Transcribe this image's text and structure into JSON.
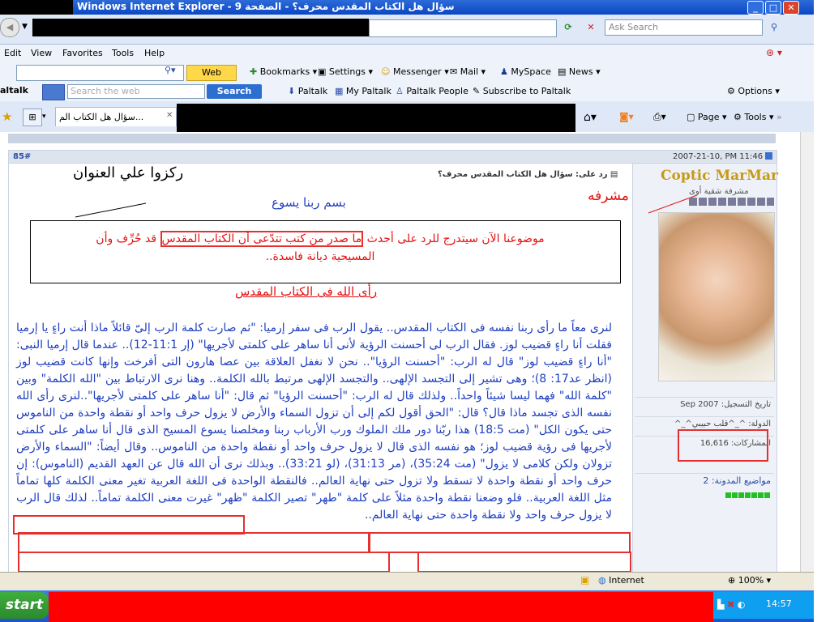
{
  "window": {
    "title": "Windows Internet Explorer - سؤال هل الكتاب المقدس محرف؟ - الصفحة 9",
    "controls": {
      "minimize": "_",
      "maximize": "□",
      "close": "✕"
    }
  },
  "address_bar": {
    "search_placeholder": "Ask Search",
    "refresh_icon": "refresh-icon",
    "stop_icon": "stop-icon"
  },
  "menu": {
    "items": [
      "Edit",
      "View",
      "Favorites",
      "Tools",
      "Help"
    ]
  },
  "toolbar1": {
    "web_search": "Web Search",
    "bookmarks": "Bookmarks",
    "settings": "Settings",
    "messenger": "Messenger",
    "mail": "Mail",
    "myspace": "MySpace",
    "news": "News"
  },
  "toolbar2": {
    "brand": "altalk",
    "search_placeholder": "Search the web",
    "search_button": "Search",
    "paltalk": "Paltalk",
    "my_paltalk": "My Paltalk",
    "paltalk_people": "Paltalk People",
    "subscribe": "Subscribe to Paltalk",
    "options": "Options"
  },
  "tabs": {
    "active_tab": "سؤال هل الكتاب الم...",
    "page_menu": "Page",
    "tools_menu": "Tools"
  },
  "post": {
    "number": "85#",
    "datetime": "2007-21-10, PM 11:46",
    "reply_title": "رد على: سؤال هل الكتاب المقدس محرف؟",
    "annotation_focus": "ركزوا علي العنوان",
    "annotation_moderator": "مشرفه",
    "basmala": "بسم ربنا يسوع",
    "intro_line1_a": "موضوعنا الآن سيتدرج للرد على أحدث ",
    "intro_line1_highlight": "ما صدر من كتب تتدّعى أن الكتاب المقدس",
    "intro_line1_b": " قد حُرِّف وأن",
    "intro_line2": "المسيحية ديانة فاسدة..",
    "heading": "رأى الله فى الكتاب المقدس",
    "body": "لنرى معاً ما رأى ربنا نفسه فى الكتاب المقدس.. يقول الرب فى سفر إرميا: \"ثم صارت كلمة الرب إلىّ قائلاً ماذا أنت راءٍ يا إرميا فقلت أنا راءٍ قضيب لوز. فقال الرب لى أحسنت الرؤية لأنى أنا ساهر على كلمتى لأجريها\" (إر 11:1-12).. عندما قال إرميا النبى: \"أنا راءٍ قضيب لوز\" قال له الرب: \"أحسنت الرؤيا\".. نحن لا نغفل العلاقة بين عصا هارون التى أفرخت وإنها كانت قضيب لوز (انظر عد17: 8)؛ وهى تشير إلى التجسد الإلهى.. والتجسد الإلهى مرتبط بالله الكلمة.. وهنا نرى الارتباط بين \"الله الكلمة\" وبين \"كلمة الله\" فهما ليسا شيئاً واحداً.. ولذلك قال له الرب: \"أحسنت الرؤيا\" ثم قال: \"أنا ساهر على كلمتى لأجريها\"..لنرى رأى الله نفسه الذى تجسد ماذا قال؟ قال: \"الحق أقول لكم إلى أن تزول السماء والأرض لا يزول حرف واحد أو نقطة واحدة من الناموس حتى يكون الكل\" (مت 18:5) هذا ربّنا دور ملك الملوك ورب الأرباب ربنا ومخلصنا يسوع المسيح الذى قال أنا ساهر على كلمتى لأجريها فى رؤية قضيب لوز؛ هو نفسه الذى قال لا يزول حرف واحد أو نقطة واحدة من الناموس.. وقال أيضاً: \"السماء والأرض تزولان ولكن كلامى لا يزول\" (مت 35:24)، (مر 31:13)، (لو 33:21).. وبذلك نرى أن الله قال عن العهد القديم (الناموس): إن حرف واحد أو نقطة واحدة لا تسقط ولا تزول حتى نهاية العالم.. فالنقطة الواحدة فى اللغة العربية تغير معنى الكلمة كلها تماماً مثل اللغة العربية.. فلو وضعنا نقطة واحدة مثلاً على كلمة \"طهر\" تصير الكلمة \"ظهر\" غيرت معنى الكلمة تماماً.. لذلك قال الرب لا يزول حرف واحد ولا نقطة واحدة حتى نهاية العالم.."
  },
  "author": {
    "username": "Coptic MarMar",
    "rank": "مشرفة شقية أوى",
    "join_date": "تاريخ التسجيل: Sep 2007",
    "country": "الدولة: ^_^قلب حبيبي^_^",
    "posts": "المشاركات: 16,616",
    "blog_topics": "مواضيع المدونة: 2",
    "reputation_fill": 1.0
  },
  "status": {
    "zone": "Internet",
    "zoom": "100%"
  },
  "taskbar": {
    "start": "start",
    "clock": "14:57"
  }
}
